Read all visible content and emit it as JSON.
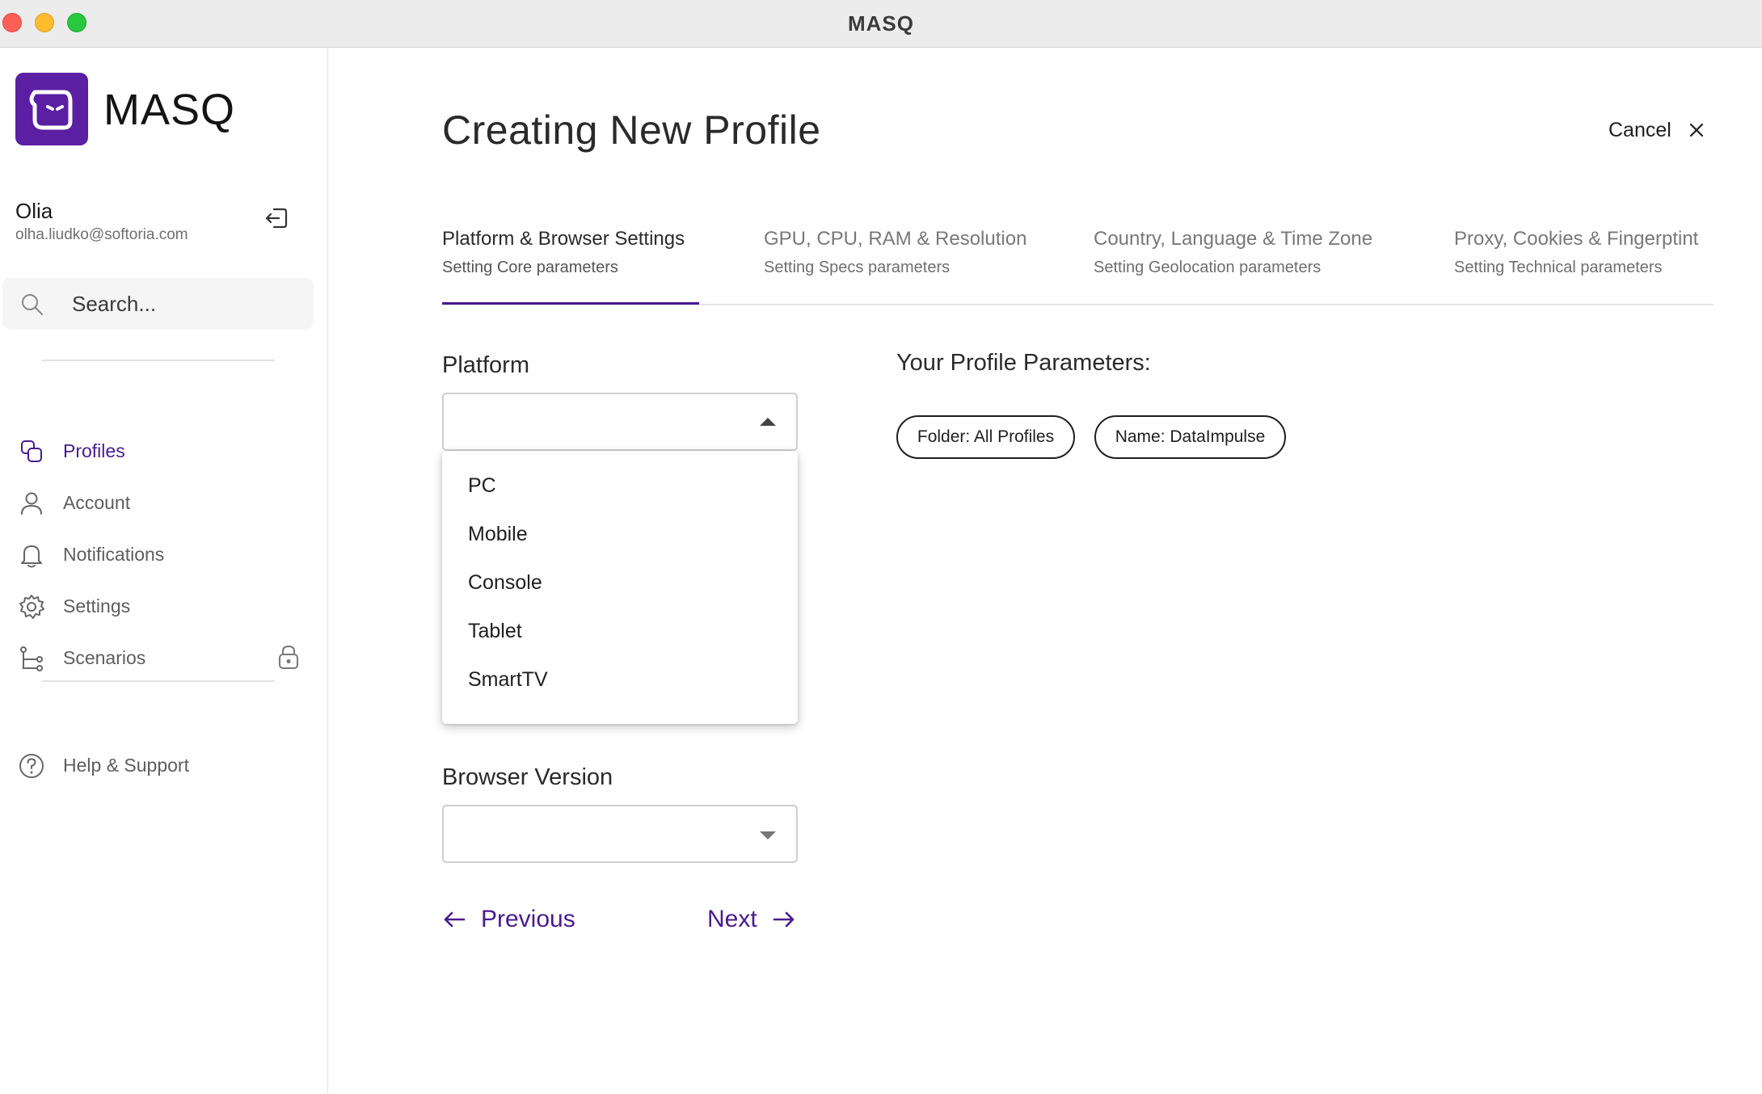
{
  "window": {
    "title": "MASQ"
  },
  "brand": {
    "name": "MASQ",
    "accent": "#4a1b8f",
    "logo_bg": "#5a1fa3"
  },
  "user": {
    "name": "Olia",
    "email": "olha.liudko@softoria.com"
  },
  "search": {
    "placeholder": "Search..."
  },
  "sidebar": {
    "items": [
      {
        "label": "Profiles",
        "icon": "profiles-icon",
        "active": true
      },
      {
        "label": "Account",
        "icon": "user-icon"
      },
      {
        "label": "Notifications",
        "icon": "bell-icon"
      },
      {
        "label": "Settings",
        "icon": "gear-icon"
      },
      {
        "label": "Scenarios",
        "icon": "scenarios-icon",
        "locked": true
      }
    ],
    "help": {
      "label": "Help & Support",
      "icon": "help-icon"
    }
  },
  "main": {
    "title": "Creating New Profile",
    "cancel_label": "Cancel",
    "tabs": [
      {
        "title": "Platform & Browser Settings",
        "subtitle": "Setting Core parameters",
        "active": true
      },
      {
        "title": "GPU, CPU, RAM & Resolution",
        "subtitle": "Setting Specs parameters"
      },
      {
        "title": "Country, Language & Time Zone",
        "subtitle": "Setting Geolocation parameters"
      },
      {
        "title": "Proxy, Cookies & Fingerptint",
        "subtitle": "Setting Technical parameters"
      }
    ],
    "platform": {
      "label": "Platform",
      "value": "",
      "options": [
        "PC",
        "Mobile",
        "Console",
        "Tablet",
        "SmartTV"
      ]
    },
    "browser_version": {
      "label": "Browser Version",
      "value": ""
    },
    "params": {
      "title": "Your Profile Parameters:",
      "chips": [
        "Folder: All Profiles",
        "Name: DataImpulse"
      ]
    },
    "previous_label": "Previous",
    "next_label": "Next"
  }
}
